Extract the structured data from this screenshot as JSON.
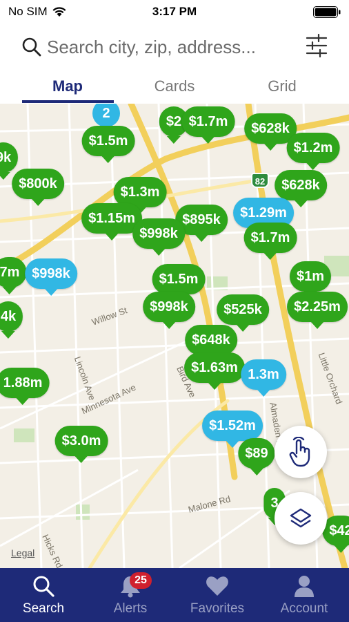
{
  "status_bar": {
    "carrier": "No SIM",
    "time": "3:17 PM"
  },
  "search": {
    "placeholder": "Search city, zip, address..."
  },
  "tabs": [
    {
      "label": "Map",
      "active": true
    },
    {
      "label": "Cards",
      "active": false
    },
    {
      "label": "Grid",
      "active": false
    }
  ],
  "map": {
    "cluster_count": "2",
    "highway_number": "82",
    "legal": "Legal",
    "street_labels": {
      "willow": "Willow St",
      "lincoln": "Lincoln Ave",
      "minnesota": "Minnesota Ave",
      "malone": "Malone Rd",
      "hicks": "Hicks Rd",
      "little": "Little Orchard",
      "bird": "Bird Ave",
      "almaden": "Almaden Rd"
    },
    "price_pins": [
      {
        "label": "$1.5m",
        "color": "green"
      },
      {
        "label": "$2",
        "color": "green"
      },
      {
        "label": "$1.7m",
        "color": "green"
      },
      {
        "label": "$628k",
        "color": "green"
      },
      {
        "label": "$1.2m",
        "color": "green"
      },
      {
        "label": "9k",
        "color": "green"
      },
      {
        "label": "$800k",
        "color": "green"
      },
      {
        "label": "$628k",
        "color": "green"
      },
      {
        "label": "$1.3m",
        "color": "green"
      },
      {
        "label": "$1.15m",
        "color": "green"
      },
      {
        "label": "$895k",
        "color": "green"
      },
      {
        "label": "$998k",
        "color": "green"
      },
      {
        "label": "$1.29m",
        "color": "blue"
      },
      {
        "label": "$1.7m",
        "color": "green"
      },
      {
        "label": "7m",
        "color": "green"
      },
      {
        "label": "$998k",
        "color": "blue"
      },
      {
        "label": "$1.5m",
        "color": "green"
      },
      {
        "label": "$1m",
        "color": "green"
      },
      {
        "label": "$998k",
        "color": "green"
      },
      {
        "label": "$525k",
        "color": "green"
      },
      {
        "label": "$2.25m",
        "color": "green"
      },
      {
        "label": "4k",
        "color": "green"
      },
      {
        "label": "$648k",
        "color": "green"
      },
      {
        "label": "1.88m",
        "color": "green"
      },
      {
        "label": "$1.63m",
        "color": "green"
      },
      {
        "label": "1.3m",
        "color": "blue"
      },
      {
        "label": "$3.0m",
        "color": "green"
      },
      {
        "label": "$1.52m",
        "color": "blue"
      },
      {
        "label": "$89",
        "color": "green"
      },
      {
        "label": "3",
        "color": "green"
      },
      {
        "label": "$42",
        "color": "green"
      }
    ]
  },
  "tab_bar": {
    "items": [
      {
        "label": "Search",
        "icon": "search-icon",
        "active": true
      },
      {
        "label": "Alerts",
        "icon": "bell-icon",
        "badge": "25"
      },
      {
        "label": "Favorites",
        "icon": "heart-icon"
      },
      {
        "label": "Account",
        "icon": "person-icon"
      }
    ]
  },
  "colors": {
    "brand": "#1e2a78",
    "pin_green": "#2fa51b",
    "pin_blue": "#31b7e4",
    "badge": "#d0202e"
  }
}
